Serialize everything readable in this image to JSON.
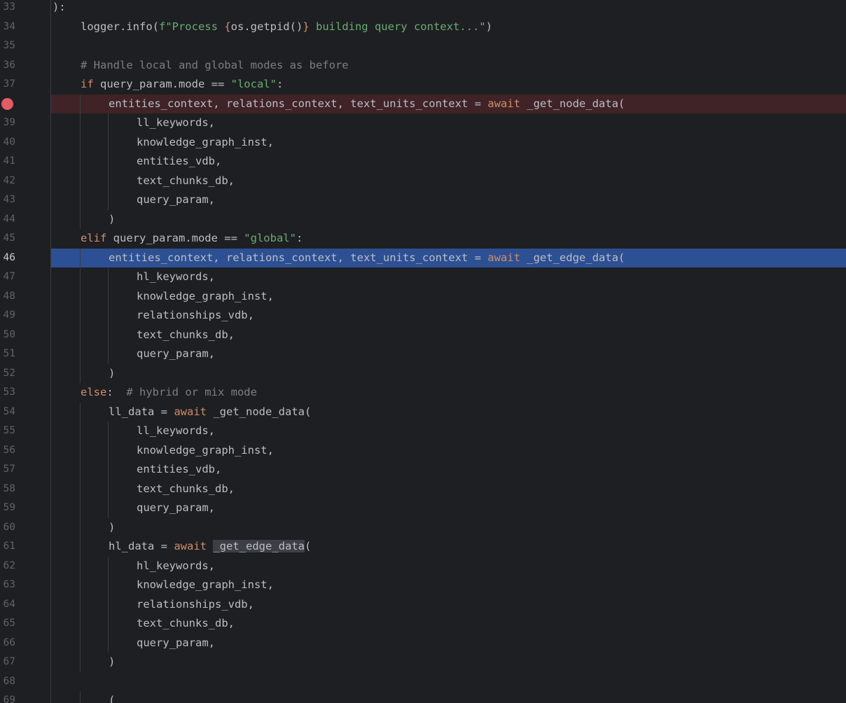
{
  "editor": {
    "breakpoint_line": "38",
    "current_line": "46",
    "lines": [
      {
        "n": "33",
        "indent": 0,
        "tokens": [
          {
            "t": "):",
            "c": ""
          }
        ]
      },
      {
        "n": "34",
        "indent": 1,
        "tokens": [
          {
            "t": "logger.info(",
            "c": ""
          },
          {
            "t": "f\"Process ",
            "c": "str"
          },
          {
            "t": "{",
            "c": "kw"
          },
          {
            "t": "os.getpid()",
            "c": ""
          },
          {
            "t": "}",
            "c": "kw"
          },
          {
            "t": " building query context...\"",
            "c": "str"
          },
          {
            "t": ")",
            "c": ""
          }
        ]
      },
      {
        "n": "35",
        "indent": 1,
        "tokens": []
      },
      {
        "n": "36",
        "indent": 1,
        "tokens": [
          {
            "t": "# Handle local and global modes as before",
            "c": "cm"
          }
        ]
      },
      {
        "n": "37",
        "indent": 1,
        "tokens": [
          {
            "t": "if",
            "c": "kw"
          },
          {
            "t": " query_param.mode == ",
            "c": ""
          },
          {
            "t": "\"local\"",
            "c": "str"
          },
          {
            "t": ":",
            "c": ""
          }
        ]
      },
      {
        "n": "38",
        "indent": 2,
        "tokens": [
          {
            "t": "entities_context, relations_context, text_units_context = ",
            "c": ""
          },
          {
            "t": "await",
            "c": "kw"
          },
          {
            "t": " _get_node_data(",
            "c": ""
          }
        ]
      },
      {
        "n": "39",
        "indent": 3,
        "tokens": [
          {
            "t": "ll_keywords,",
            "c": ""
          }
        ]
      },
      {
        "n": "40",
        "indent": 3,
        "tokens": [
          {
            "t": "knowledge_graph_inst,",
            "c": ""
          }
        ]
      },
      {
        "n": "41",
        "indent": 3,
        "tokens": [
          {
            "t": "entities_vdb,",
            "c": ""
          }
        ]
      },
      {
        "n": "42",
        "indent": 3,
        "tokens": [
          {
            "t": "text_chunks_db,",
            "c": ""
          }
        ]
      },
      {
        "n": "43",
        "indent": 3,
        "tokens": [
          {
            "t": "query_param,",
            "c": ""
          }
        ]
      },
      {
        "n": "44",
        "indent": 2,
        "tokens": [
          {
            "t": ")",
            "c": ""
          }
        ]
      },
      {
        "n": "45",
        "indent": 1,
        "tokens": [
          {
            "t": "elif",
            "c": "kw"
          },
          {
            "t": " query_param.mode == ",
            "c": ""
          },
          {
            "t": "\"global\"",
            "c": "str"
          },
          {
            "t": ":",
            "c": ""
          }
        ]
      },
      {
        "n": "46",
        "indent": 2,
        "tokens": [
          {
            "t": "entities_context, relations_context, text_units_context = ",
            "c": ""
          },
          {
            "t": "await",
            "c": "kw"
          },
          {
            "t": " _get_edge_data(",
            "c": ""
          }
        ]
      },
      {
        "n": "47",
        "indent": 3,
        "tokens": [
          {
            "t": "hl_keywords,",
            "c": ""
          }
        ]
      },
      {
        "n": "48",
        "indent": 3,
        "tokens": [
          {
            "t": "knowledge_graph_inst,",
            "c": ""
          }
        ]
      },
      {
        "n": "49",
        "indent": 3,
        "tokens": [
          {
            "t": "relationships_vdb,",
            "c": ""
          }
        ]
      },
      {
        "n": "50",
        "indent": 3,
        "tokens": [
          {
            "t": "text_chunks_db,",
            "c": ""
          }
        ]
      },
      {
        "n": "51",
        "indent": 3,
        "tokens": [
          {
            "t": "query_param,",
            "c": ""
          }
        ]
      },
      {
        "n": "52",
        "indent": 2,
        "tokens": [
          {
            "t": ")",
            "c": ""
          }
        ]
      },
      {
        "n": "53",
        "indent": 1,
        "tokens": [
          {
            "t": "else",
            "c": "kw"
          },
          {
            "t": ":  ",
            "c": ""
          },
          {
            "t": "# hybrid or mix mode",
            "c": "cm"
          }
        ]
      },
      {
        "n": "54",
        "indent": 2,
        "tokens": [
          {
            "t": "ll_data = ",
            "c": ""
          },
          {
            "t": "await",
            "c": "kw"
          },
          {
            "t": " _get_node_data(",
            "c": ""
          }
        ]
      },
      {
        "n": "55",
        "indent": 3,
        "tokens": [
          {
            "t": "ll_keywords,",
            "c": ""
          }
        ]
      },
      {
        "n": "56",
        "indent": 3,
        "tokens": [
          {
            "t": "knowledge_graph_inst,",
            "c": ""
          }
        ]
      },
      {
        "n": "57",
        "indent": 3,
        "tokens": [
          {
            "t": "entities_vdb,",
            "c": ""
          }
        ]
      },
      {
        "n": "58",
        "indent": 3,
        "tokens": [
          {
            "t": "text_chunks_db,",
            "c": ""
          }
        ]
      },
      {
        "n": "59",
        "indent": 3,
        "tokens": [
          {
            "t": "query_param,",
            "c": ""
          }
        ]
      },
      {
        "n": "60",
        "indent": 2,
        "tokens": [
          {
            "t": ")",
            "c": ""
          }
        ]
      },
      {
        "n": "61",
        "indent": 2,
        "tokens": [
          {
            "t": "hl_data = ",
            "c": ""
          },
          {
            "t": "await",
            "c": "kw"
          },
          {
            "t": " ",
            "c": ""
          },
          {
            "t": "_get_edge_data",
            "c": "hl"
          },
          {
            "t": "(",
            "c": ""
          }
        ]
      },
      {
        "n": "62",
        "indent": 3,
        "tokens": [
          {
            "t": "hl_keywords,",
            "c": ""
          }
        ]
      },
      {
        "n": "63",
        "indent": 3,
        "tokens": [
          {
            "t": "knowledge_graph_inst,",
            "c": ""
          }
        ]
      },
      {
        "n": "64",
        "indent": 3,
        "tokens": [
          {
            "t": "relationships_vdb,",
            "c": ""
          }
        ]
      },
      {
        "n": "65",
        "indent": 3,
        "tokens": [
          {
            "t": "text_chunks_db,",
            "c": ""
          }
        ]
      },
      {
        "n": "66",
        "indent": 3,
        "tokens": [
          {
            "t": "query_param,",
            "c": ""
          }
        ]
      },
      {
        "n": "67",
        "indent": 2,
        "tokens": [
          {
            "t": ")",
            "c": ""
          }
        ]
      },
      {
        "n": "68",
        "indent": 1,
        "tokens": []
      },
      {
        "n": "69",
        "indent": 2,
        "tokens": [
          {
            "t": "(",
            "c": ""
          }
        ]
      }
    ]
  }
}
